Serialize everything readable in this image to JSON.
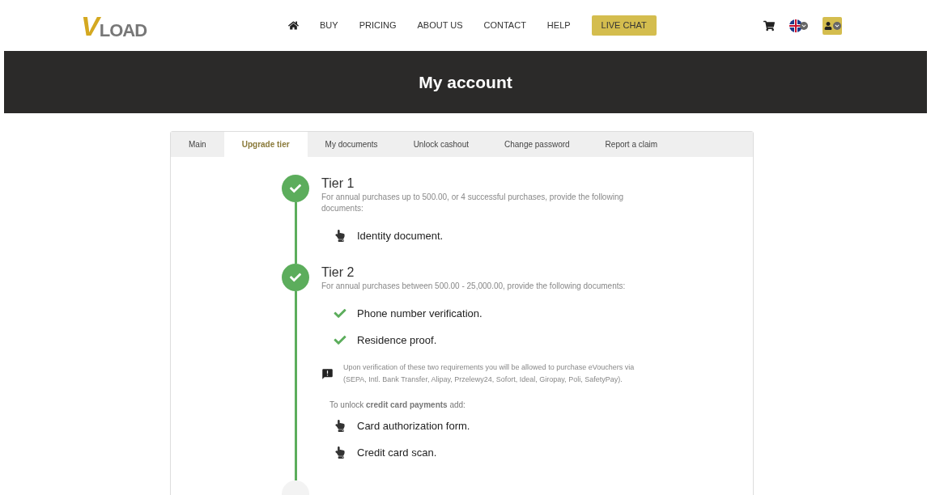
{
  "logo": {
    "mark": "V",
    "text": "LOAD"
  },
  "nav": [
    {
      "kind": "home"
    },
    {
      "kind": "link",
      "label": "BUY"
    },
    {
      "kind": "link",
      "label": "PRICING"
    },
    {
      "kind": "link",
      "label": "ABOUT US"
    },
    {
      "kind": "link",
      "label": "CONTACT"
    },
    {
      "kind": "link",
      "label": "HELP"
    },
    {
      "kind": "chat",
      "label": "LIVE CHAT"
    }
  ],
  "page_title": "My account",
  "tabs": [
    {
      "label": "Main",
      "selected": false
    },
    {
      "label": "Upgrade tier",
      "selected": true
    },
    {
      "label": "My documents",
      "selected": false
    },
    {
      "label": "Unlock cashout",
      "selected": false
    },
    {
      "label": "Change password",
      "selected": false
    },
    {
      "label": "Report a claim",
      "selected": false
    }
  ],
  "tiers": [
    {
      "title": "Tier 1",
      "done": true,
      "description": "For annual purchases up to 500.00, or 4 successful purchases, provide the following documents:",
      "blocks": [
        {
          "kind": "item",
          "label": "Identity document.",
          "done": false
        }
      ]
    },
    {
      "title": "Tier 2",
      "done": true,
      "description": "For annual purchases between 500.00 - 25,000.00, provide the following documents:",
      "blocks": [
        {
          "kind": "item",
          "label": "Phone number verification.",
          "done": true
        },
        {
          "kind": "item",
          "label": "Residence proof.",
          "done": true
        },
        {
          "kind": "note",
          "text": "Upon verification of these two requirements you will be allowed to purchase eVouchers via (SEPA, Intl. Bank Transfer, Alipay, Przelewy24, Sofort, Ideal, Giropay, Poli, SafetyPay)."
        },
        {
          "kind": "intro",
          "text": "To unlock **credit card payments** add:"
        },
        {
          "kind": "item",
          "label": "Card authorization form.",
          "done": false
        },
        {
          "kind": "item",
          "label": "Credit card scan.",
          "done": false
        }
      ]
    },
    {
      "done": false
    }
  ]
}
